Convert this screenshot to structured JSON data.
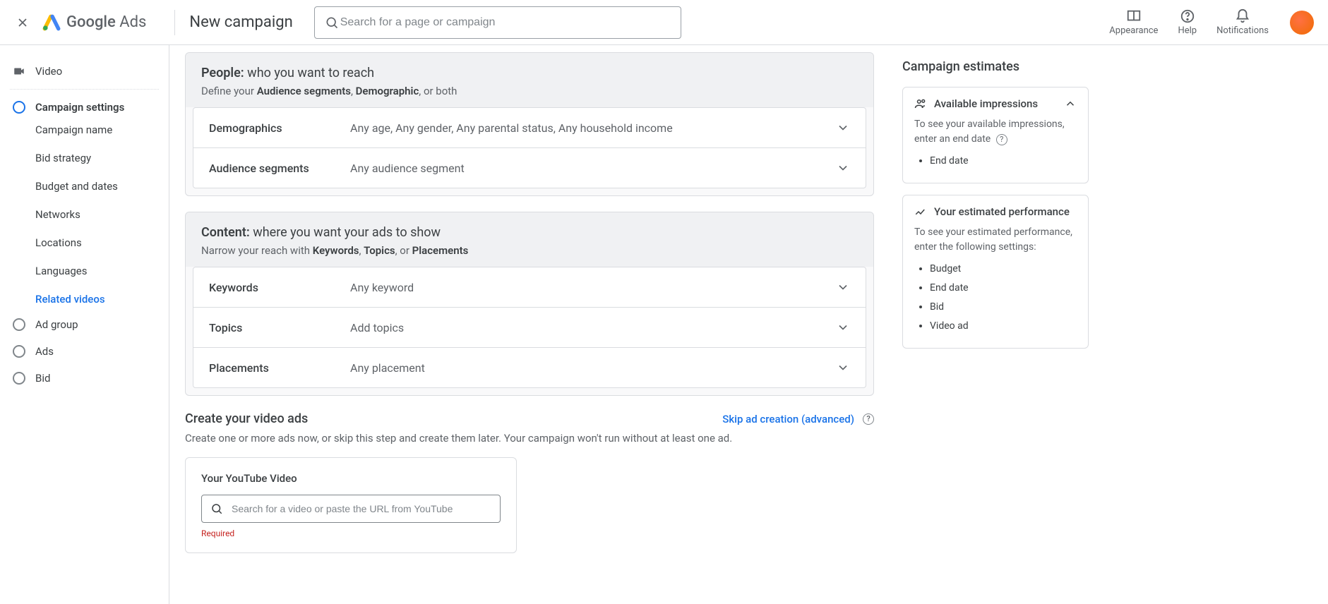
{
  "header": {
    "product_a": "Google",
    "product_b": "Ads",
    "page_title": "New campaign",
    "search_placeholder": "Search for a page or campaign",
    "tools": {
      "appearance": "Appearance",
      "help": "Help",
      "notifications": "Notifications"
    }
  },
  "sidebar": {
    "video": "Video",
    "campaign_settings": "Campaign settings",
    "items": {
      "campaign_name": "Campaign name",
      "bid_strategy": "Bid strategy",
      "budget_dates": "Budget and dates",
      "networks": "Networks",
      "locations": "Locations",
      "languages": "Languages",
      "related_videos": "Related videos"
    },
    "ad_group": "Ad group",
    "ads": "Ads",
    "bid": "Bid"
  },
  "people": {
    "title_bold": "People:",
    "title_rest": " who you want to reach",
    "sub_pre": "Define your ",
    "sub_b1": "Audience segments",
    "sub_mid": ", ",
    "sub_b2": "Demographic",
    "sub_post": ", or both",
    "demographics_label": "Demographics",
    "demographics_value": "Any age, Any gender, Any parental status, Any household income",
    "audience_label": "Audience segments",
    "audience_value": "Any audience segment"
  },
  "content": {
    "title_bold": "Content:",
    "title_rest": " where you want your ads to show",
    "sub_pre": "Narrow your reach with ",
    "sub_b1": "Keywords",
    "sub_m1": ", ",
    "sub_b2": "Topics",
    "sub_m2": ", or ",
    "sub_b3": "Placements",
    "keywords_label": "Keywords",
    "keywords_value": "Any keyword",
    "topics_label": "Topics",
    "topics_value": "Add topics",
    "placements_label": "Placements",
    "placements_value": "Any placement"
  },
  "video_section": {
    "title": "Create your video ads",
    "skip": "Skip ad creation (advanced)",
    "sub": "Create one or more ads now, or skip this step and create them later. Your campaign won't run without at least one ad.",
    "card_title": "Your YouTube Video",
    "search_placeholder": "Search for a video or paste the URL from YouTube",
    "required": "Required"
  },
  "estimates": {
    "heading": "Campaign estimates",
    "impressions_title": "Available impressions",
    "impressions_body": "To see your available impressions, enter an end date",
    "impressions_li1": "End date",
    "perf_title": "Your estimated performance",
    "perf_body": "To see your estimated performance, enter the following settings:",
    "perf_li1": "Budget",
    "perf_li2": "End date",
    "perf_li3": "Bid",
    "perf_li4": "Video ad"
  }
}
